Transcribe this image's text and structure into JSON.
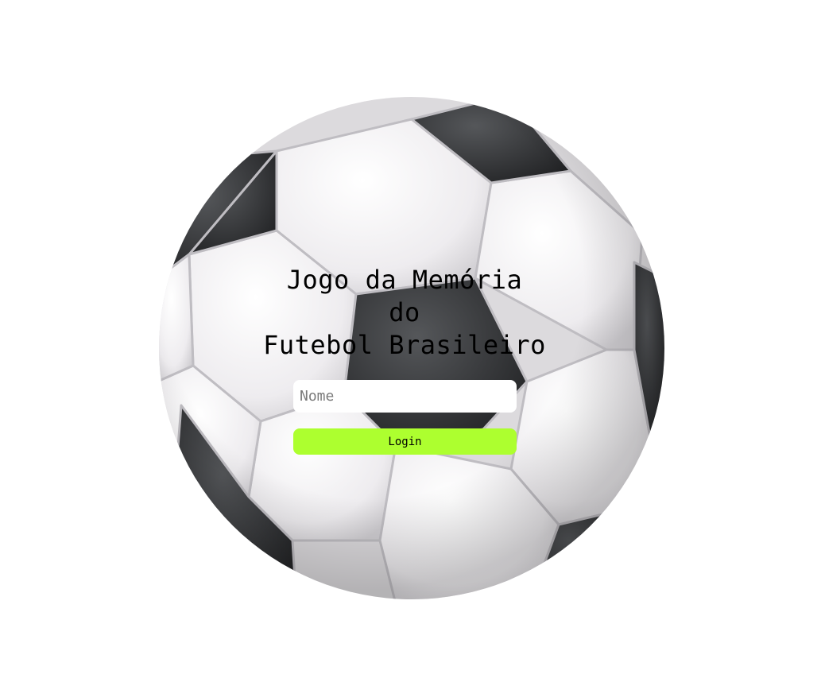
{
  "title": {
    "line1": "Jogo da Memória",
    "line2": "do",
    "line3": "Futebol Brasileiro"
  },
  "form": {
    "name_placeholder": "Nome",
    "name_value": "",
    "login_label": "Login"
  },
  "colors": {
    "login_button": "#adff2f",
    "background": "#ffffff",
    "ball_dark_patch": "#3a3b3d",
    "ball_white_patch": "#f1eff2"
  },
  "background_image": "soccer-ball"
}
